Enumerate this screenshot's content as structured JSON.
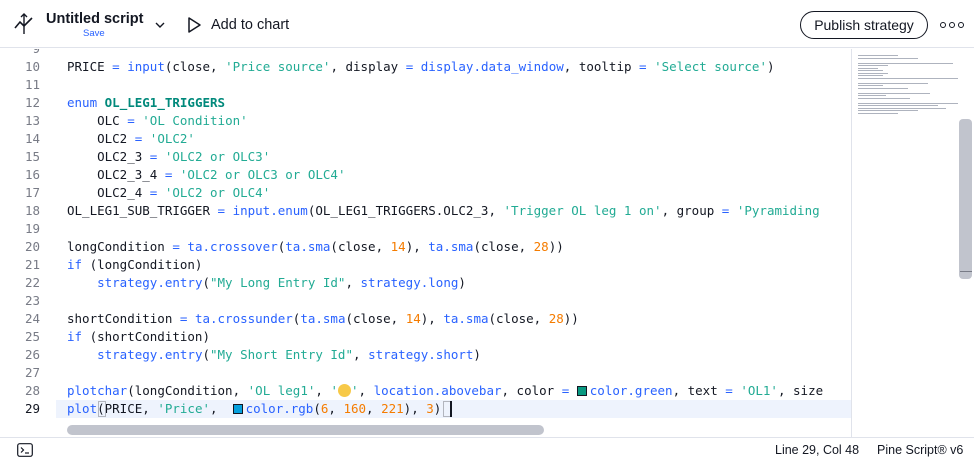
{
  "header": {
    "title": "Untitled script",
    "save_label": "Save",
    "add_to_chart_label": "Add to chart",
    "publish_label": "Publish strategy",
    "more_icon": "more-horizontal-icon"
  },
  "editor": {
    "first_partial_line": "9",
    "lines": [
      {
        "n": "10",
        "tokens": [
          [
            "PRICE ",
            "var"
          ],
          [
            "= ",
            "op"
          ],
          [
            "input",
            "fn"
          ],
          [
            "(close, ",
            "var"
          ],
          [
            "'Price source'",
            "str"
          ],
          [
            ", display ",
            "var"
          ],
          [
            "= ",
            "op"
          ],
          [
            "display.data_window",
            "fn"
          ],
          [
            ", tooltip ",
            "var"
          ],
          [
            "= ",
            "op"
          ],
          [
            "'Select source'",
            "str"
          ],
          [
            ")",
            "var"
          ]
        ]
      },
      {
        "n": "11",
        "tokens": []
      },
      {
        "n": "12",
        "tokens": [
          [
            "enum ",
            "kw"
          ],
          [
            "OL_LEG1_TRIGGERS",
            "name"
          ]
        ]
      },
      {
        "n": "13",
        "tokens": [
          [
            "    OLC ",
            "var"
          ],
          [
            "= ",
            "op"
          ],
          [
            "'OL Condition'",
            "str"
          ]
        ]
      },
      {
        "n": "14",
        "tokens": [
          [
            "    OLC2 ",
            "var"
          ],
          [
            "= ",
            "op"
          ],
          [
            "'OLC2'",
            "str"
          ]
        ]
      },
      {
        "n": "15",
        "tokens": [
          [
            "    OLC2_3 ",
            "var"
          ],
          [
            "= ",
            "op"
          ],
          [
            "'OLC2 or OLC3'",
            "str"
          ]
        ]
      },
      {
        "n": "16",
        "tokens": [
          [
            "    OLC2_3_4 ",
            "var"
          ],
          [
            "= ",
            "op"
          ],
          [
            "'OLC2 or OLC3 or OLC4'",
            "str"
          ]
        ]
      },
      {
        "n": "17",
        "tokens": [
          [
            "    OLC2_4 ",
            "var"
          ],
          [
            "= ",
            "op"
          ],
          [
            "'OLC2 or OLC4'",
            "str"
          ]
        ]
      },
      {
        "n": "18",
        "tokens": [
          [
            "OL_LEG1_SUB_TRIGGER ",
            "var"
          ],
          [
            "= ",
            "op"
          ],
          [
            "input.enum",
            "fn"
          ],
          [
            "(OL_LEG1_TRIGGERS.OLC2_3, ",
            "var"
          ],
          [
            "'Trigger OL leg 1 on'",
            "str"
          ],
          [
            ", group ",
            "var"
          ],
          [
            "= ",
            "op"
          ],
          [
            "'Pyramiding",
            "str"
          ]
        ]
      },
      {
        "n": "19",
        "tokens": []
      },
      {
        "n": "20",
        "tokens": [
          [
            "longCondition ",
            "var"
          ],
          [
            "= ",
            "op"
          ],
          [
            "ta.crossover",
            "fn"
          ],
          [
            "(",
            "var"
          ],
          [
            "ta.sma",
            "fn"
          ],
          [
            "(close, ",
            "var"
          ],
          [
            "14",
            "num"
          ],
          [
            "), ",
            "var"
          ],
          [
            "ta.sma",
            "fn"
          ],
          [
            "(close, ",
            "var"
          ],
          [
            "28",
            "num"
          ],
          [
            "))",
            "var"
          ]
        ]
      },
      {
        "n": "21",
        "tokens": [
          [
            "if ",
            "kw"
          ],
          [
            "(longCondition)",
            "var"
          ]
        ]
      },
      {
        "n": "22",
        "tokens": [
          [
            "    ",
            "var"
          ],
          [
            "strategy.entry",
            "fn"
          ],
          [
            "(",
            "var"
          ],
          [
            "\"My Long Entry Id\"",
            "str"
          ],
          [
            ", ",
            "var"
          ],
          [
            "strategy.long",
            "fn"
          ],
          [
            ")",
            "var"
          ]
        ]
      },
      {
        "n": "23",
        "tokens": []
      },
      {
        "n": "24",
        "tokens": [
          [
            "shortCondition ",
            "var"
          ],
          [
            "= ",
            "op"
          ],
          [
            "ta.crossunder",
            "fn"
          ],
          [
            "(",
            "var"
          ],
          [
            "ta.sma",
            "fn"
          ],
          [
            "(close, ",
            "var"
          ],
          [
            "14",
            "num"
          ],
          [
            "), ",
            "var"
          ],
          [
            "ta.sma",
            "fn"
          ],
          [
            "(close, ",
            "var"
          ],
          [
            "28",
            "num"
          ],
          [
            "))",
            "var"
          ]
        ]
      },
      {
        "n": "25",
        "tokens": [
          [
            "if ",
            "kw"
          ],
          [
            "(shortCondition)",
            "var"
          ]
        ]
      },
      {
        "n": "26",
        "tokens": [
          [
            "    ",
            "var"
          ],
          [
            "strategy.entry",
            "fn"
          ],
          [
            "(",
            "var"
          ],
          [
            "\"My Short Entry Id\"",
            "str"
          ],
          [
            ", ",
            "var"
          ],
          [
            "strategy.short",
            "fn"
          ],
          [
            ")",
            "var"
          ]
        ]
      },
      {
        "n": "27",
        "tokens": []
      },
      {
        "n": "28",
        "tokens": [
          [
            "plotchar",
            "fn"
          ],
          [
            "(longCondition, ",
            "var"
          ],
          [
            "'OL leg1'",
            "str"
          ],
          [
            ", ",
            "var"
          ],
          [
            "'",
            "str"
          ],
          [
            "#emoji",
            "emoji"
          ],
          [
            "'",
            "str"
          ],
          [
            ", ",
            "var"
          ],
          [
            "location.abovebar",
            "fn"
          ],
          [
            ", color ",
            "var"
          ],
          [
            "= ",
            "op"
          ],
          [
            "#swatch:#089981",
            "swatch"
          ],
          [
            "color.green",
            "fn"
          ],
          [
            ", text ",
            "var"
          ],
          [
            "= ",
            "op"
          ],
          [
            "'OL1'",
            "str"
          ],
          [
            ", size",
            "var"
          ]
        ]
      },
      {
        "n": "29",
        "tokens": [
          [
            "plot",
            "fn"
          ],
          [
            "(PRICE, ",
            "var"
          ],
          [
            "'Price'",
            "str"
          ],
          [
            ",  ",
            "var"
          ],
          [
            "#swatch:#06a0dd",
            "swatch"
          ],
          [
            "color.rgb",
            "fn"
          ],
          [
            "(",
            "var"
          ],
          [
            "6",
            "num"
          ],
          [
            ", ",
            "var"
          ],
          [
            "160",
            "num"
          ],
          [
            ", ",
            "var"
          ],
          [
            "221",
            "num"
          ],
          [
            "), ",
            "var"
          ],
          [
            "3",
            "num"
          ],
          [
            ")",
            "var"
          ]
        ]
      }
    ]
  },
  "status": {
    "position": "Line 29, Col 48",
    "language": "Pine Script® v6"
  },
  "colors": {
    "accent": "#2962ff",
    "string": "#22ab94",
    "number": "#f57c00",
    "keyword_teal": "#00897b",
    "text": "#131722"
  }
}
